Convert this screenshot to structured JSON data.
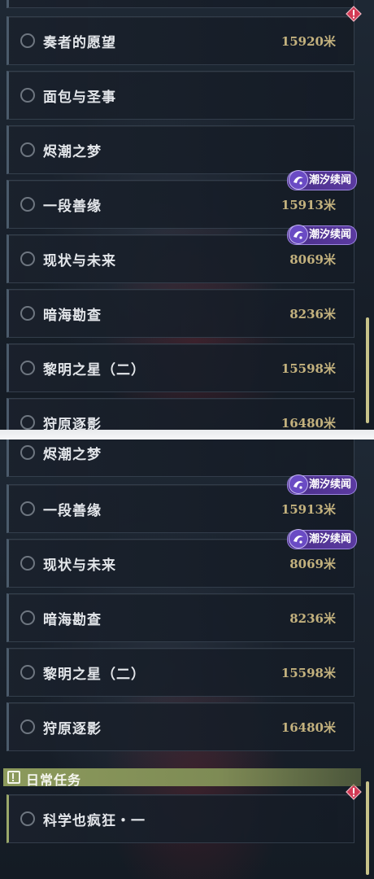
{
  "top_panel": {
    "quests": [
      {
        "name": "奏者的愿望",
        "distance": "15920米",
        "alert": true
      },
      {
        "name": "面包与圣事",
        "distance": ""
      },
      {
        "name": "烬潮之梦",
        "distance": ""
      },
      {
        "name": "一段善缘",
        "distance": "15913米",
        "badge": "潮汐续闻"
      },
      {
        "name": "现状与未来",
        "distance": "8069米",
        "badge": "潮汐续闻"
      },
      {
        "name": "暗海勘查",
        "distance": "8236米"
      },
      {
        "name": "黎明之星（二）",
        "distance": "15598米"
      },
      {
        "name": "狩原逐影",
        "distance": "16480米"
      }
    ]
  },
  "bottom_panel": {
    "quests": [
      {
        "name": "烬潮之梦",
        "distance": ""
      },
      {
        "name": "一段善缘",
        "distance": "15913米",
        "badge": "潮汐续闻"
      },
      {
        "name": "现状与未来",
        "distance": "8069米",
        "badge": "潮汐续闻"
      },
      {
        "name": "暗海勘查",
        "distance": "8236米"
      },
      {
        "name": "黎明之星（二）",
        "distance": "15598米"
      },
      {
        "name": "狩原逐影",
        "distance": "16480米"
      }
    ],
    "daily_section": {
      "title": "日常任务",
      "quests": [
        {
          "name": "科学也疯狂・一",
          "distance": "",
          "alert": true
        }
      ]
    }
  },
  "colors": {
    "distance": "#c4b27e",
    "badge": "#5b3aa0",
    "alert": "#d23a55",
    "daily_header": "#8c9a5c"
  }
}
